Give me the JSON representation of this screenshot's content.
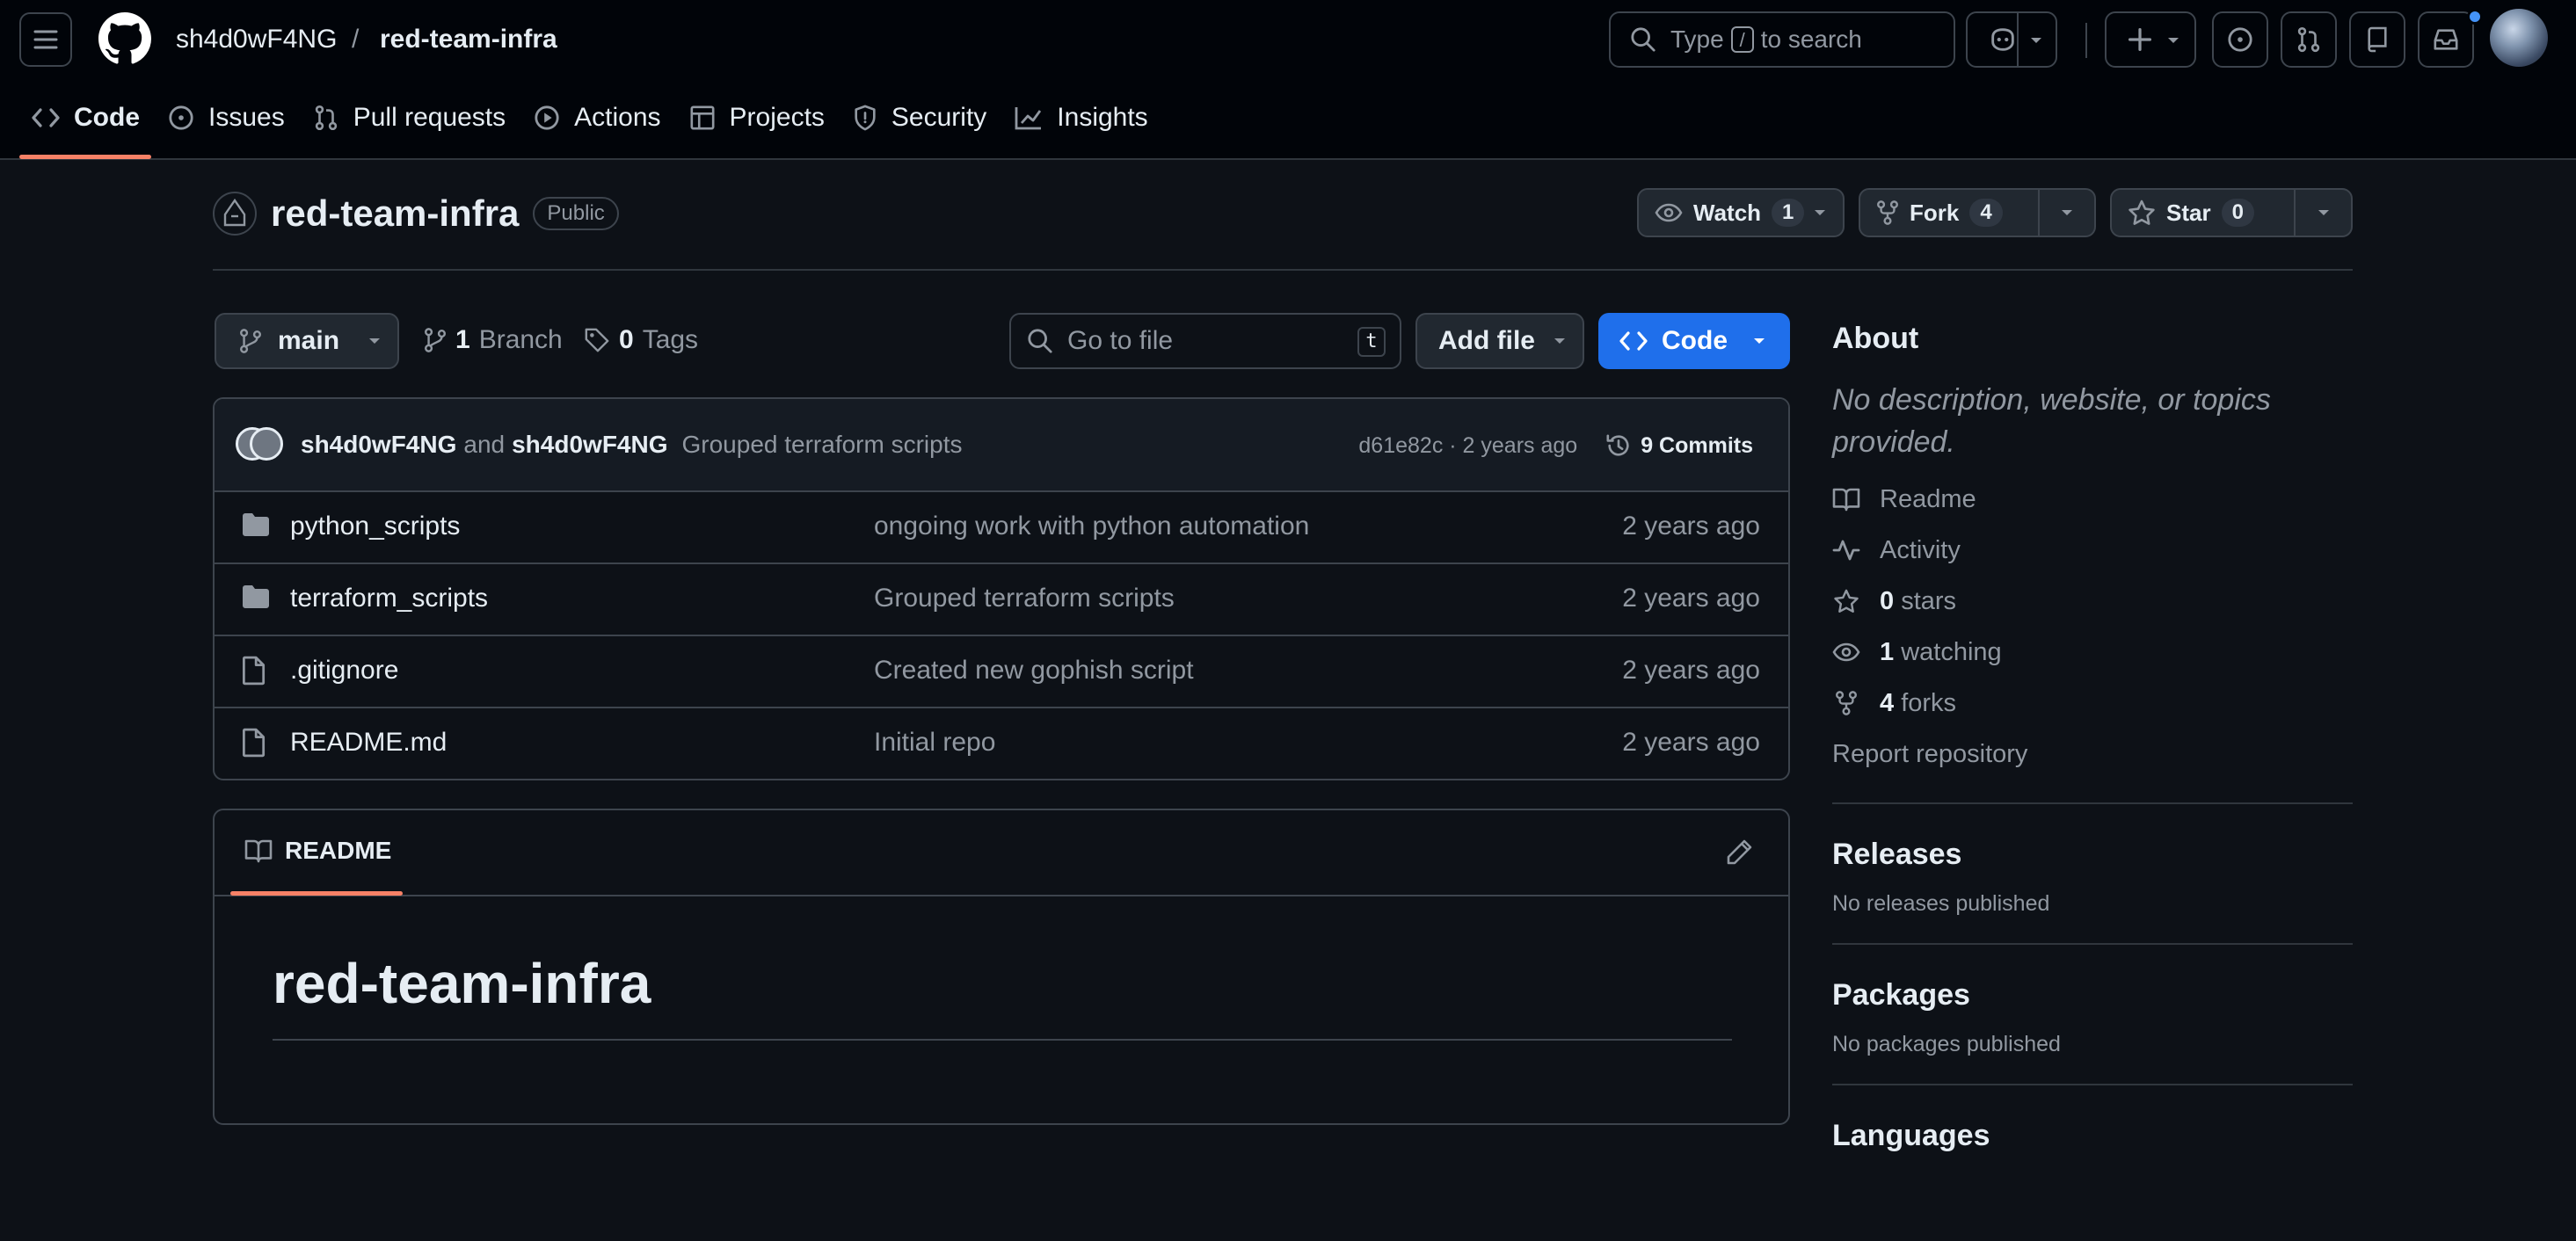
{
  "header": {
    "owner": "sh4d0wF4NG",
    "separator": "/",
    "repo": "red-team-infra",
    "search": {
      "type_label": "Type",
      "key": "/",
      "suffix": "to search"
    }
  },
  "repo_nav": [
    {
      "label": "Code",
      "icon": "code-icon"
    },
    {
      "label": "Issues",
      "icon": "issue-icon"
    },
    {
      "label": "Pull requests",
      "icon": "pull-request-icon"
    },
    {
      "label": "Actions",
      "icon": "play-icon"
    },
    {
      "label": "Projects",
      "icon": "table-icon"
    },
    {
      "label": "Security",
      "icon": "shield-icon"
    },
    {
      "label": "Insights",
      "icon": "graph-icon"
    }
  ],
  "repo": {
    "name": "red-team-infra",
    "visibility": "Public",
    "watch": {
      "label": "Watch",
      "count": "1"
    },
    "fork": {
      "label": "Fork",
      "count": "4"
    },
    "star": {
      "label": "Star",
      "count": "0"
    }
  },
  "toolbar": {
    "branch": "main",
    "branches_count": "1",
    "branches_label": "Branch",
    "tags_count": "0",
    "tags_label": "Tags",
    "goto_placeholder": "Go to file",
    "goto_key": "t",
    "add_file": "Add file",
    "code": "Code"
  },
  "last_commit": {
    "author1": "sh4d0wF4NG",
    "and": "and",
    "author2": "sh4d0wF4NG",
    "message": "Grouped terraform scripts",
    "meta": "d61e82c · 2 years ago",
    "commits": "9 Commits"
  },
  "files": [
    {
      "name": "python_scripts",
      "type": "folder",
      "message": "ongoing work with python automation",
      "date": "2 years ago"
    },
    {
      "name": "terraform_scripts",
      "type": "folder",
      "message": "Grouped terraform scripts",
      "date": "2 years ago"
    },
    {
      "name": ".gitignore",
      "type": "file",
      "message": "Created new gophish script",
      "date": "2 years ago"
    },
    {
      "name": "README.md",
      "type": "file",
      "message": "Initial repo",
      "date": "2 years ago"
    }
  ],
  "readme": {
    "tab": "README",
    "heading": "red-team-infra"
  },
  "about": {
    "title": "About",
    "description": "No description, website, or topics provided.",
    "readme": "Readme",
    "activity": "Activity",
    "stars_count": "0",
    "stars_label": "stars",
    "watching_count": "1",
    "watching_label": "watching",
    "forks_count": "4",
    "forks_label": "forks",
    "report": "Report repository"
  },
  "releases": {
    "title": "Releases",
    "empty": "No releases published"
  },
  "packages": {
    "title": "Packages",
    "empty": "No packages published"
  },
  "languages": {
    "title": "Languages"
  },
  "colors": {
    "accent": "#1f6feb",
    "underline": "#f78166",
    "bg": "#0d1117"
  }
}
